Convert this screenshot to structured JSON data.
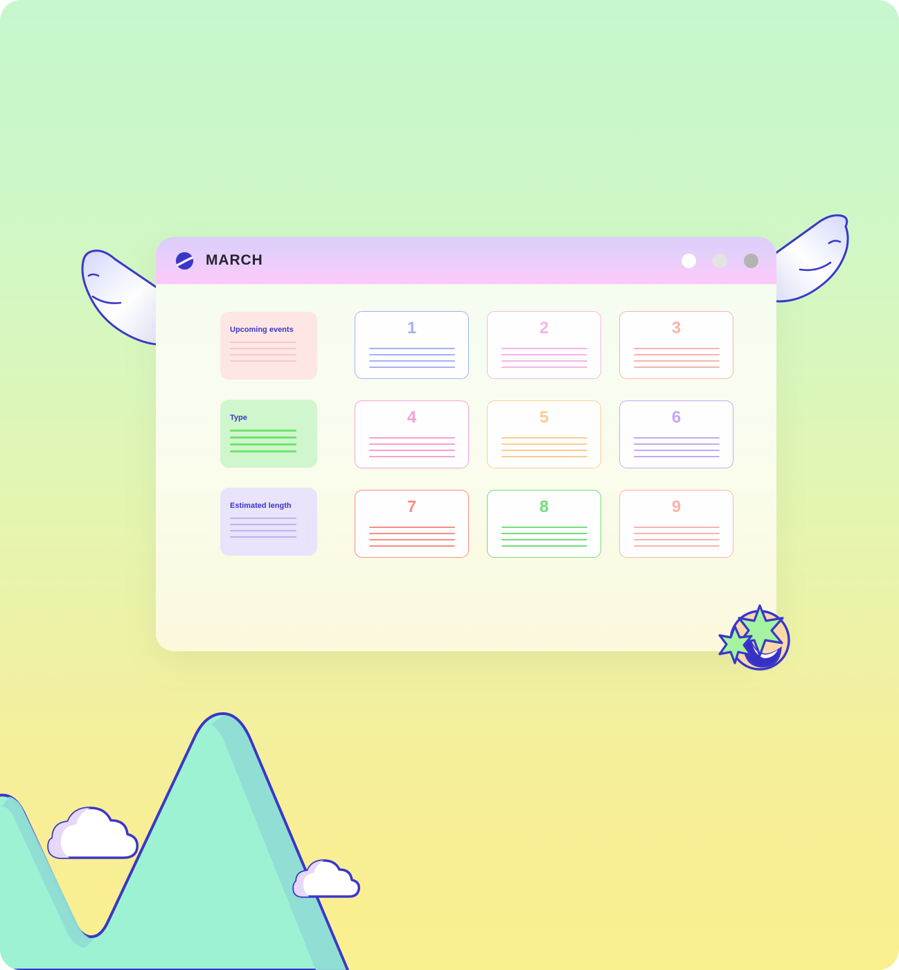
{
  "window": {
    "title": "MARCH",
    "logo_icon": "planet-logo-icon",
    "controls": [
      {
        "name": "window-control-minimize",
        "color": "#FFFFFF"
      },
      {
        "name": "window-control-maximize",
        "color": "#E4E3E4"
      },
      {
        "name": "window-control-close",
        "color": "#B4B3B4"
      }
    ],
    "header_gradient": [
      "#DCCDFA",
      "#FBC9FB"
    ],
    "body_background": "#F7FDF0"
  },
  "sidebar": {
    "cards": [
      {
        "label": "Upcoming events",
        "bg": "#FDE6E4",
        "line_color": "#F9C7C2",
        "lines": 4
      },
      {
        "label": "Type",
        "bg": "#CFF6CD",
        "line_color": "#6EE36B",
        "lines": 4
      },
      {
        "label": "Estimated length",
        "bg": "#E9E3FB",
        "line_color": "#BDB2F0",
        "lines": 4
      }
    ],
    "label_color": "#3A37C8"
  },
  "grid": {
    "cards": [
      {
        "number": "1",
        "accent": "#A5B0F5",
        "lines": 4
      },
      {
        "number": "2",
        "accent": "#F9B3E8",
        "lines": 4
      },
      {
        "number": "3",
        "accent": "#F9B3AC",
        "lines": 4
      },
      {
        "number": "4",
        "accent": "#F79FD2",
        "lines": 4
      },
      {
        "number": "5",
        "accent": "#FACD8E",
        "lines": 4
      },
      {
        "number": "6",
        "accent": "#C4A7F7",
        "lines": 4
      },
      {
        "number": "7",
        "accent": "#F98D86",
        "lines": 4
      },
      {
        "number": "8",
        "accent": "#72DD7B",
        "lines": 4
      },
      {
        "number": "9",
        "accent": "#FAB3AC",
        "lines": 4
      }
    ]
  },
  "decorations": {
    "wing_left": "wing-left-icon",
    "wing_right": "wing-right-icon",
    "emoji": "star-struck-emoji-icon",
    "mountains": "mountain-landscape-icon",
    "clouds": 2,
    "palette": {
      "background_top": "#C6F7CD",
      "background_bottom": "#FAF08E",
      "mountain_fill": "#9DF2D4",
      "mountain_shade": "#8FDCD4",
      "outline": "#3A37C8",
      "wing_fill": "#D7DAFA",
      "emoji_face": "#FBD9A8",
      "emoji_star": "#A5F3A0",
      "emoji_mouth": "#3730C4"
    }
  }
}
